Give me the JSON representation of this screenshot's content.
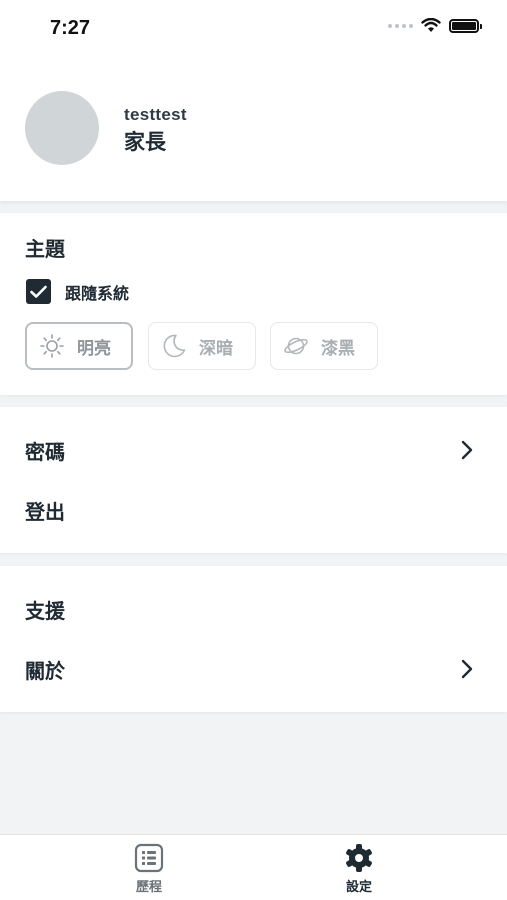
{
  "status": {
    "time": "7:27"
  },
  "profile": {
    "username": "testtest",
    "role": "家長"
  },
  "theme": {
    "title": "主題",
    "follow_system": "跟隨系統",
    "follow_checked": true,
    "options": [
      {
        "label": "明亮",
        "icon": "sun-icon",
        "selected": true
      },
      {
        "label": "深暗",
        "icon": "moon-icon",
        "selected": false
      },
      {
        "label": "漆黑",
        "icon": "planet-icon",
        "selected": false
      }
    ]
  },
  "account": {
    "password": "密碼",
    "logout": "登出"
  },
  "support": {
    "support": "支援",
    "about": "關於"
  },
  "tabs": [
    {
      "label": "歷程",
      "icon": "history-icon",
      "active": false
    },
    {
      "label": "設定",
      "icon": "gear-icon",
      "active": true
    }
  ],
  "colors": {
    "primary_text": "#1f2a33",
    "background": "#f2f3f4",
    "avatar": "#d0d5d8"
  }
}
